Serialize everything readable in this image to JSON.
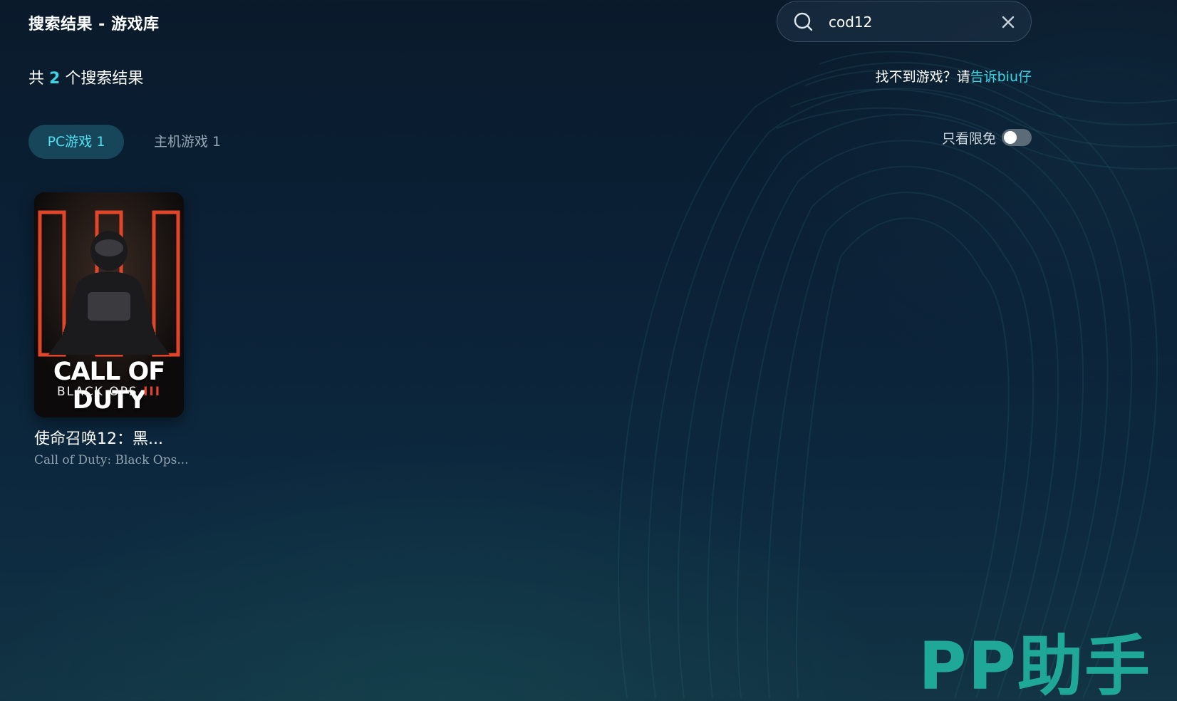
{
  "header": {
    "title": "搜索结果 - 游戏库"
  },
  "search": {
    "value": "cod12",
    "placeholder": ""
  },
  "results": {
    "prefix": "共",
    "count": "2",
    "suffix": "个搜索结果"
  },
  "feedback": {
    "text": "找不到游戏？请",
    "link": "告诉biu仔"
  },
  "tabs": [
    {
      "label": "PC游戏 1",
      "active": true
    },
    {
      "label": "主机游戏 1",
      "active": false
    }
  ],
  "filter": {
    "label": "只看限免",
    "enabled": false
  },
  "games": [
    {
      "name": "使命召唤12：黑...",
      "english_name": "Call of Duty: Black Ops...",
      "cover_title": "CALL OF DUTY",
      "cover_subtitle": "BLACK OPS",
      "cover_roman": "III"
    }
  ],
  "watermark": {
    "text": "PP助手"
  },
  "colors": {
    "accent": "#3ed6e4",
    "tab_active_bg": "#17455a",
    "watermark": "#1fa898"
  }
}
